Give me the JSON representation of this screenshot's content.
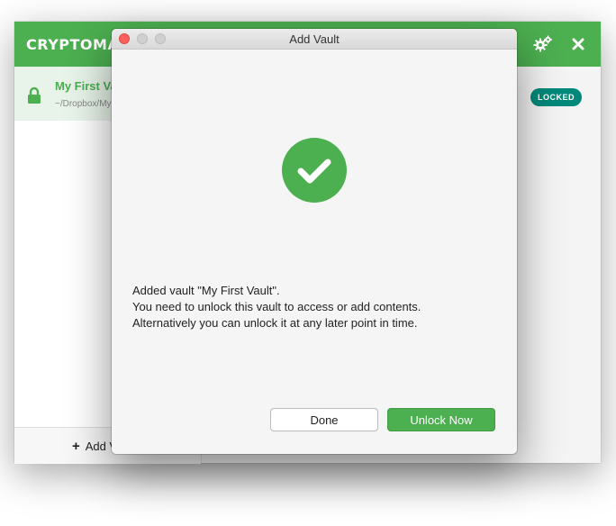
{
  "app": {
    "title": "CRYPTOMATOR",
    "brand_color": "#4caf50"
  },
  "sidebar": {
    "vault": {
      "name": "My First Vault",
      "path": "~/Dropbox/My First Vault",
      "icon": "lock-icon"
    },
    "add_label": "Add Vault"
  },
  "main": {
    "status_badge": "LOCKED",
    "badge_color": "#00897b"
  },
  "dialog": {
    "title": "Add Vault",
    "icon": "checkmark-circle-icon",
    "message_lines": [
      "Added vault \"My First Vault\".",
      "You need to unlock this vault to access or add contents.",
      "Alternatively you can unlock it at any later point in time."
    ],
    "done_label": "Done",
    "unlock_label": "Unlock Now"
  }
}
